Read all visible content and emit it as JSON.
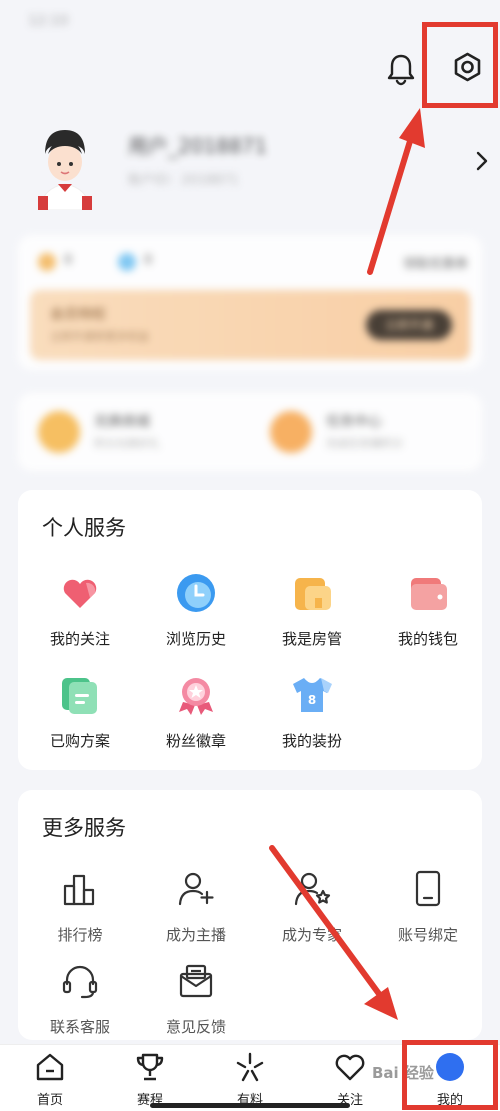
{
  "status": {
    "time": "12:10"
  },
  "profile": {
    "username": "用户_2018871",
    "subtitle": "账户ID：2018871"
  },
  "vip": {
    "row_left": "0",
    "row_mid": "0",
    "row_right": "领取优惠券",
    "banner_title": "会员特权",
    "banner_sub": "立即开通享更多权益",
    "banner_btn": "立即开通"
  },
  "mini": [
    {
      "title": "兑换商城",
      "sub": "积分兑换好礼"
    },
    {
      "title": "任务中心",
      "sub": "完成任务赚积分"
    }
  ],
  "personal": {
    "title": "个人服务",
    "items": [
      {
        "label": "我的关注",
        "icon": "heart-icon"
      },
      {
        "label": "浏览历史",
        "icon": "clock-icon"
      },
      {
        "label": "我是房管",
        "icon": "house-icon"
      },
      {
        "label": "我的钱包",
        "icon": "wallet-icon"
      },
      {
        "label": "已购方案",
        "icon": "document-icon"
      },
      {
        "label": "粉丝徽章",
        "icon": "badge-icon"
      },
      {
        "label": "我的装扮",
        "icon": "jersey-icon"
      }
    ]
  },
  "more": {
    "title": "更多服务",
    "items": [
      {
        "label": "排行榜",
        "icon": "bar-chart-icon"
      },
      {
        "label": "成为主播",
        "icon": "add-user-icon"
      },
      {
        "label": "成为专家",
        "icon": "expert-icon"
      },
      {
        "label": "账号绑定",
        "icon": "phone-icon"
      },
      {
        "label": "联系客服",
        "icon": "headset-icon"
      },
      {
        "label": "意见反馈",
        "icon": "envelope-icon"
      }
    ]
  },
  "nav": [
    {
      "label": "首页",
      "icon": "home-icon"
    },
    {
      "label": "赛程",
      "icon": "trophy-icon"
    },
    {
      "label": "有料",
      "icon": "spark-icon"
    },
    {
      "label": "关注",
      "icon": "heart-outline-icon"
    },
    {
      "label": "我的",
      "icon": "profile-icon",
      "active": true
    }
  ],
  "watermark": "Bai 经验",
  "colors": {
    "accent": "#2f6ff0",
    "annotation": "#e23a2f",
    "vip_gold": "#f9c896"
  }
}
